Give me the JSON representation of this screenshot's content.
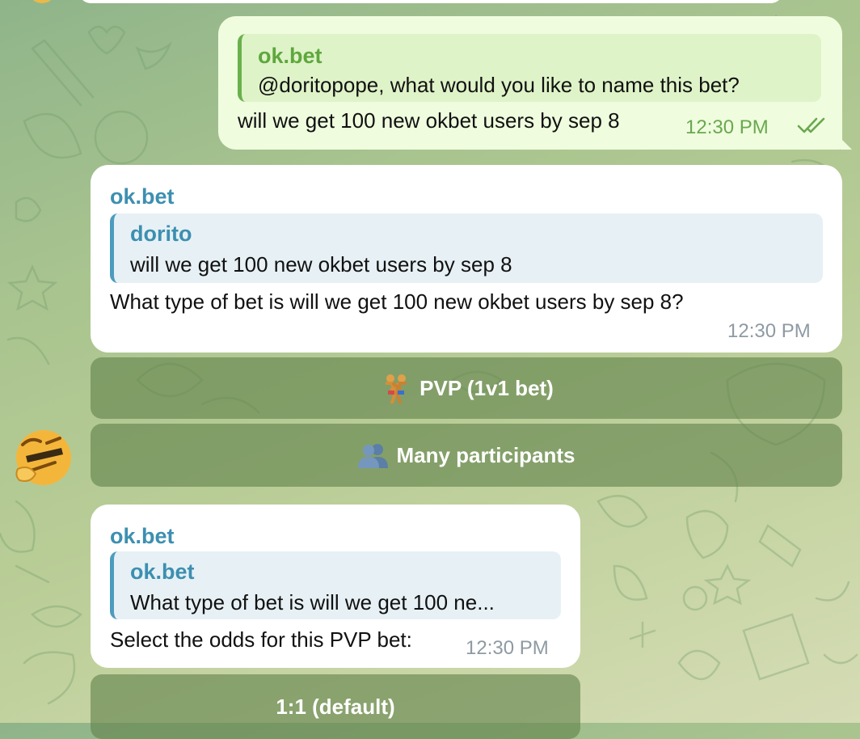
{
  "messages": [
    {
      "direction": "outgoing",
      "reply": {
        "sender": "ok.bet",
        "text": "@doritopope, what would you like to name this bet?"
      },
      "text": "will we get 100 new okbet users by sep 8",
      "time": "12:30 PM",
      "status": "read-double-check"
    },
    {
      "direction": "incoming",
      "sender": "ok.bet",
      "reply": {
        "sender": "dorito",
        "text": "will we get 100 new okbet users by sep 8"
      },
      "text": "What type of bet is will we get 100 new okbet users by sep 8?",
      "time": "12:30 PM",
      "buttons": [
        {
          "emoji": "wrestlers-emoji",
          "label": "PVP (1v1 bet)"
        },
        {
          "emoji": "people-emoji",
          "label": "Many participants"
        }
      ]
    },
    {
      "direction": "incoming",
      "sender": "ok.bet",
      "reply": {
        "sender": "ok.bet",
        "text": "What type of bet is will we get 100 ne..."
      },
      "text": "Select the odds for this PVP bet:",
      "time": "12:30 PM",
      "buttons": [
        {
          "label": "1:1 (default)"
        }
      ]
    }
  ],
  "avatar": {
    "icon": "thinking-face-sticker"
  },
  "colors": {
    "outgoing_bubble": "#effdde",
    "outgoing_accent": "#5ea73e",
    "incoming_accent": "#3d8fb0",
    "button_bg": "rgba(98,130,76,0.62)"
  }
}
